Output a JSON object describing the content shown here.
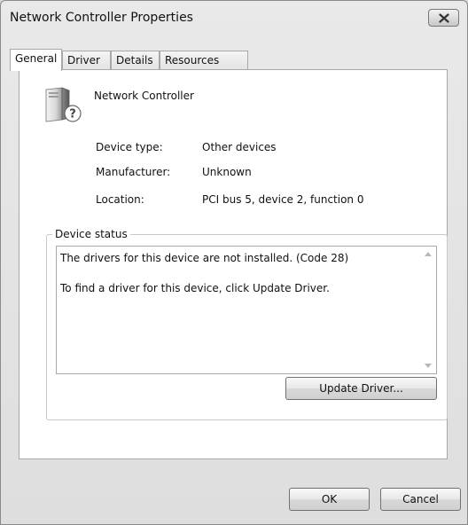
{
  "window": {
    "title": "Network Controller Properties"
  },
  "tabs": [
    {
      "label": "General",
      "active": true
    },
    {
      "label": "Driver",
      "active": false
    },
    {
      "label": "Details",
      "active": false
    },
    {
      "label": "Resources",
      "active": false
    }
  ],
  "device": {
    "icon": "unknown-device-icon",
    "name": "Network Controller",
    "properties": [
      {
        "label": "Device type:",
        "value": "Other devices"
      },
      {
        "label": "Manufacturer:",
        "value": "Unknown"
      },
      {
        "label": "Location:",
        "value": "PCI bus 5, device 2, function 0"
      }
    ]
  },
  "status": {
    "legend": "Device status",
    "line1": "The drivers for this device are not installed. (Code 28)",
    "line2": "To find a driver for this device, click Update Driver.",
    "update_button": "Update Driver..."
  },
  "footer": {
    "ok": "OK",
    "cancel": "Cancel"
  },
  "colors": {
    "window_bg": "#e4e4e4",
    "panel_bg": "#ffffff",
    "border": "#a8a8a8"
  }
}
